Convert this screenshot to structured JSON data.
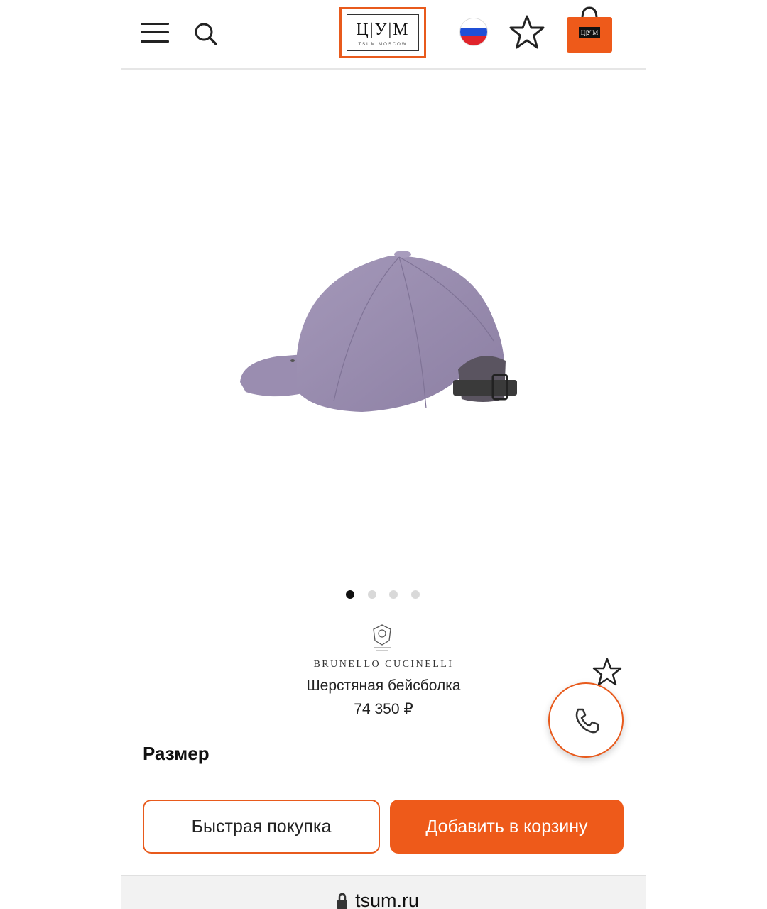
{
  "header": {
    "logo_letters": "Ц|У|М",
    "logo_sub": "TSUM MOSCOW",
    "bag_label": "Ц|У|М",
    "flag_colors": [
      "#ffffff",
      "#1f4fd6",
      "#e0242b"
    ]
  },
  "carousel": {
    "total": 4,
    "active_index": 0
  },
  "product": {
    "brand": "BRUNELLO CUCINELLI",
    "title": "Шерстяная бейсболка",
    "price": "74 350 ₽",
    "color": "#9c8fb1"
  },
  "size": {
    "label": "Размер"
  },
  "actions": {
    "quick_buy_label": "Быстрая покупка",
    "add_to_cart_label": "Добавить в корзину"
  },
  "browser": {
    "url": "tsum.ru"
  },
  "colors": {
    "accent": "#ee5a1a",
    "accent_border": "#e85a1c"
  }
}
